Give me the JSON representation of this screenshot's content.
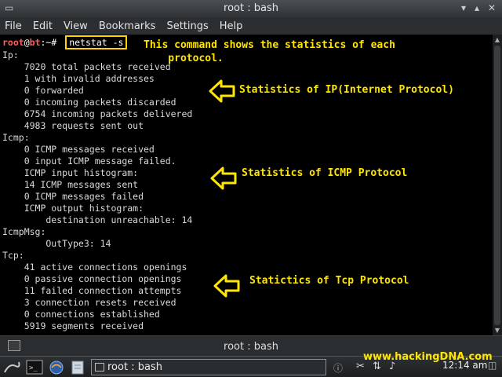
{
  "window": {
    "title": "root : bash"
  },
  "menu": [
    "File",
    "Edit",
    "View",
    "Bookmarks",
    "Settings",
    "Help"
  ],
  "prompt": {
    "user": "root",
    "host": "bt",
    "rest": ":~# ",
    "command": "netstat -s"
  },
  "output": [
    "Ip:",
    "    7020 total packets received",
    "    1 with invalid addresses",
    "    0 forwarded",
    "    0 incoming packets discarded",
    "    6754 incoming packets delivered",
    "    4983 requests sent out",
    "Icmp:",
    "    0 ICMP messages received",
    "    0 input ICMP message failed.",
    "    ICMP input histogram:",
    "    14 ICMP messages sent",
    "    0 ICMP messages failed",
    "    ICMP output histogram:",
    "        destination unreachable: 14",
    "IcmpMsg:",
    "        OutType3: 14",
    "Tcp:",
    "    41 active connections openings",
    "    0 passive connection openings",
    "    11 failed connection attempts",
    "    3 connection resets received",
    "    0 connections established",
    "    5919 segments received"
  ],
  "annotations": {
    "command": "This command shows the statistics of each\n    protocol.",
    "ip": "Statistics of IP(Internet Protocol)",
    "icmp": "Statistics of ICMP Protocol",
    "tcp": "Statictics of Tcp Protocol"
  },
  "tabbar": {
    "tab_label": "root : bash"
  },
  "taskbar": {
    "task_label": "root : bash",
    "clock": "12:14 am"
  },
  "watermark": "www.hackingDNA.com",
  "colors": {
    "annotation": "#ffe600",
    "prompt": "#ff5f5f",
    "background": "#000000"
  },
  "icons": [
    "window-menu-icon",
    "minimize-icon",
    "maximize-icon",
    "close-icon",
    "kde-menu-icon",
    "terminal-icon",
    "browser-icon",
    "files-icon",
    "scissors-icon",
    "network-icon",
    "volume-icon"
  ]
}
